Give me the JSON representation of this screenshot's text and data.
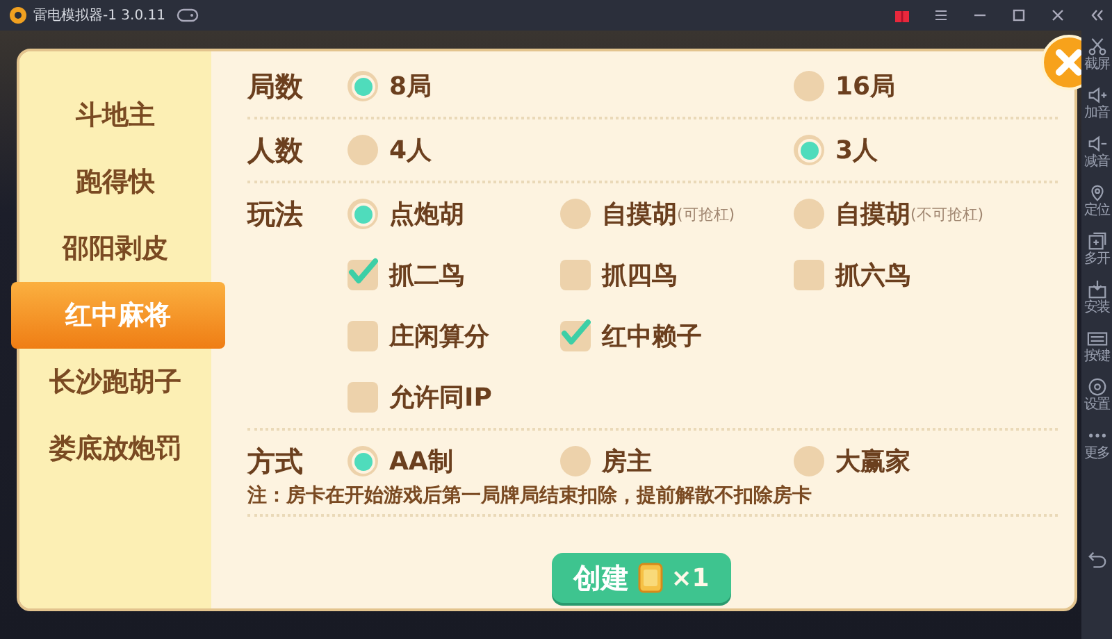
{
  "window": {
    "title": "雷电模拟器-1 3.0.11"
  },
  "tool_sidebar": [
    {
      "kind": "scissors",
      "label": "截屏"
    },
    {
      "kind": "volume-up",
      "label": "加音"
    },
    {
      "kind": "volume-down",
      "label": "减音"
    },
    {
      "kind": "location",
      "label": "定位"
    },
    {
      "kind": "multi",
      "label": "多开"
    },
    {
      "kind": "install",
      "label": "安装"
    },
    {
      "kind": "keyboard",
      "label": "按键"
    },
    {
      "kind": "settings",
      "label": "设置"
    },
    {
      "kind": "more",
      "label": "更多"
    }
  ],
  "dialog": {
    "tabs": [
      {
        "label": "斗地主",
        "selected": false
      },
      {
        "label": "跑得快",
        "selected": false
      },
      {
        "label": "邵阳剥皮",
        "selected": false
      },
      {
        "label": "红中麻将",
        "selected": true
      },
      {
        "label": "长沙跑胡子",
        "selected": false
      },
      {
        "label": "娄底放炮罚",
        "selected": false
      }
    ],
    "sections": [
      {
        "label": "局数",
        "rows": [
          [
            {
              "kind": "radio",
              "text": "8局",
              "selected": true
            },
            {
              "kind": "radio",
              "text": "16局",
              "selected": false
            }
          ]
        ]
      },
      {
        "label": "人数",
        "rows": [
          [
            {
              "kind": "radio",
              "text": "4人",
              "selected": false
            },
            {
              "kind": "radio",
              "text": "3人",
              "selected": true
            }
          ]
        ]
      },
      {
        "label": "玩法",
        "rows": [
          [
            {
              "kind": "radio",
              "text": "点炮胡",
              "selected": true
            },
            {
              "kind": "radio",
              "text": "自摸胡",
              "note": "(可抢杠)",
              "selected": false
            },
            {
              "kind": "radio",
              "text": "自摸胡",
              "note": "(不可抢杠)",
              "selected": false
            }
          ],
          [
            {
              "kind": "checkbox",
              "text": "抓二鸟",
              "checked": true
            },
            {
              "kind": "checkbox",
              "text": "抓四鸟",
              "checked": false
            },
            {
              "kind": "checkbox",
              "text": "抓六鸟",
              "checked": false
            }
          ],
          [
            {
              "kind": "checkbox",
              "text": "庄闲算分",
              "checked": false
            },
            {
              "kind": "checkbox",
              "text": "红中赖子",
              "checked": true
            }
          ],
          [
            {
              "kind": "checkbox",
              "text": "允许同IP",
              "checked": false
            }
          ]
        ]
      },
      {
        "label": "方式",
        "rows": [
          [
            {
              "kind": "radio",
              "text": "AA制",
              "selected": true
            },
            {
              "kind": "radio",
              "text": "房主",
              "selected": false
            },
            {
              "kind": "radio",
              "text": "大赢家",
              "selected": false
            }
          ]
        ],
        "note": "注：房卡在开始游戏后第一局牌局结束扣除，提前解散不扣除房卡"
      }
    ],
    "create_button": {
      "label": "创建",
      "count": "×1"
    }
  }
}
